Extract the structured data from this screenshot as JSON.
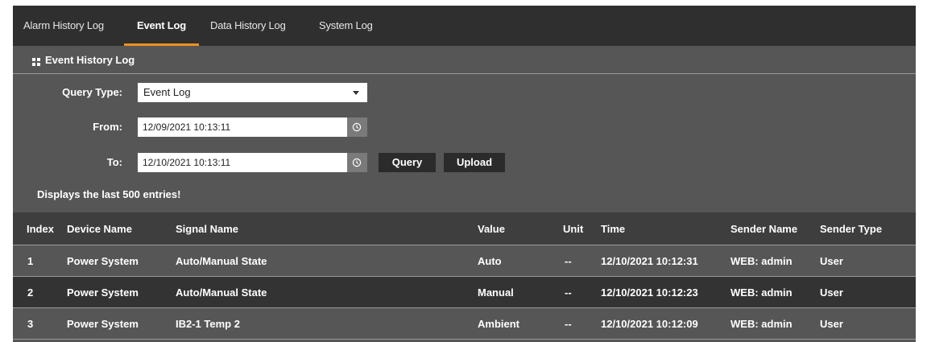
{
  "tabs": [
    {
      "label": "Alarm History Log",
      "active": false
    },
    {
      "label": "Event Log",
      "active": true
    },
    {
      "label": "Data History Log",
      "active": false
    },
    {
      "label": "System Log",
      "active": false
    }
  ],
  "panel": {
    "title": "Event History Log",
    "icon": "grid-icon"
  },
  "form": {
    "query_type_label": "Query Type:",
    "query_type_value": "Event Log",
    "from_label": "From:",
    "from_value": "12/09/2021 10:13:11",
    "to_label": "To:",
    "to_value": "12/10/2021 10:13:11",
    "query_button": "Query",
    "upload_button": "Upload",
    "note": "Displays the last 500 entries!"
  },
  "table": {
    "headers": [
      "Index",
      "Device Name",
      "Signal Name",
      "Value",
      "Unit",
      "Time",
      "Sender Name",
      "Sender Type"
    ],
    "rows": [
      [
        "1",
        "Power System",
        "Auto/Manual State",
        "Auto",
        "--",
        "12/10/2021 10:12:31",
        "WEB: admin",
        "User"
      ],
      [
        "2",
        "Power System",
        "Auto/Manual State",
        "Manual",
        "--",
        "12/10/2021 10:12:23",
        "WEB: admin",
        "User"
      ],
      [
        "3",
        "Power System",
        "IB2-1 Temp 2",
        "Ambient",
        "--",
        "12/10/2021 10:12:09",
        "WEB: admin",
        "User"
      ]
    ]
  },
  "colors": {
    "accent": "#f0901e",
    "tab_bar": "#2f2f2f",
    "panel": "#565656",
    "header_row": "#3e3e3e",
    "alt_row": "#333333"
  }
}
